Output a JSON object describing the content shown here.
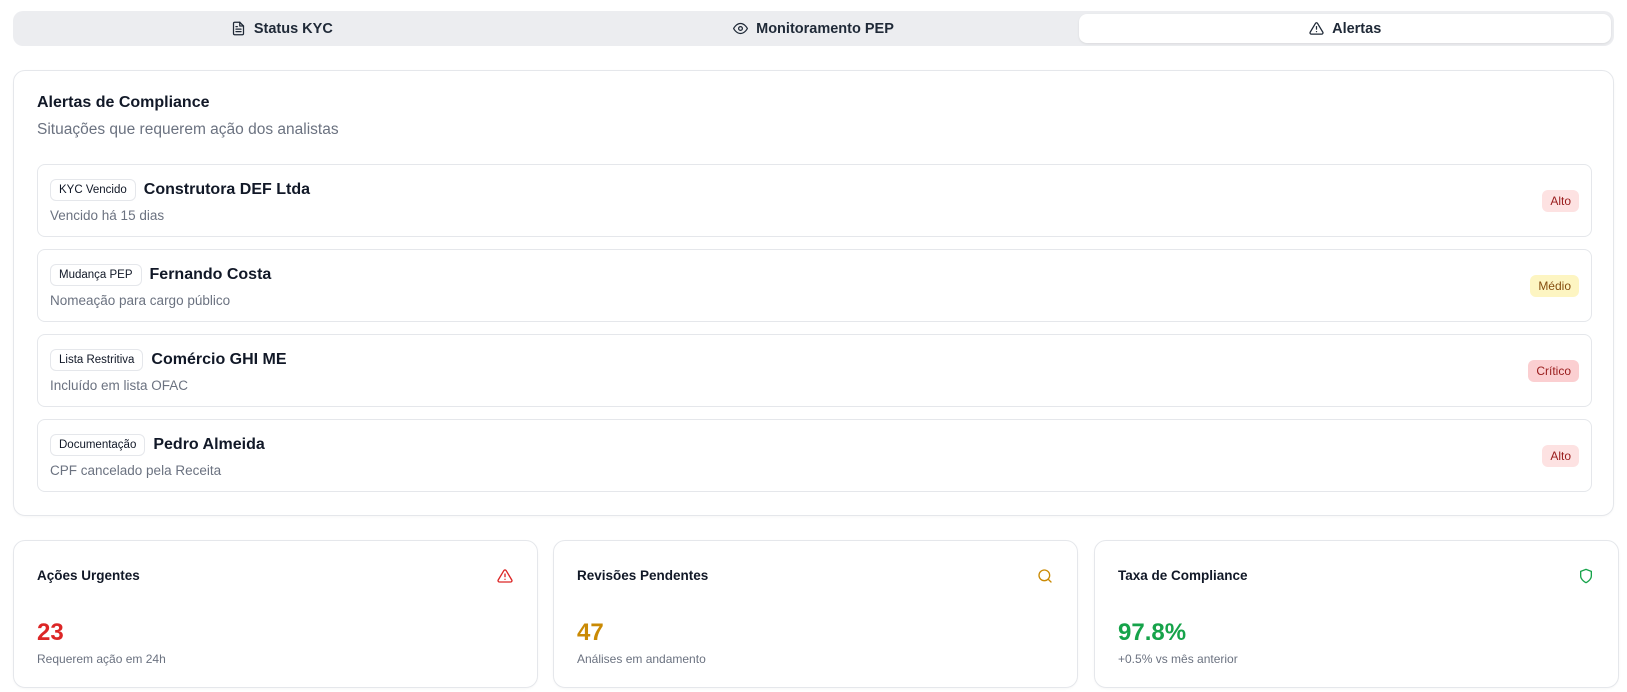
{
  "tabs": [
    {
      "label": "Status KYC",
      "icon": "document-icon",
      "active": false
    },
    {
      "label": "Monitoramento PEP",
      "icon": "eye-icon",
      "active": false
    },
    {
      "label": "Alertas",
      "icon": "warning-triangle-icon",
      "active": true
    }
  ],
  "alerts_card": {
    "title": "Alertas de Compliance",
    "subtitle": "Situações que requerem ação dos analistas",
    "items": [
      {
        "type": "KYC Vencido",
        "name": "Construtora DEF Ltda",
        "description": "Vencido há 15 dias",
        "severity": "Alto"
      },
      {
        "type": "Mudança PEP",
        "name": "Fernando Costa",
        "description": "Nomeação para cargo público",
        "severity": "Médio"
      },
      {
        "type": "Lista Restritiva",
        "name": "Comércio GHI ME",
        "description": "Incluído em lista OFAC",
        "severity": "Crítico"
      },
      {
        "type": "Documentação",
        "name": "Pedro Almeida",
        "description": "CPF cancelado pela Receita",
        "severity": "Alto"
      }
    ]
  },
  "stats": [
    {
      "title": "Ações Urgentes",
      "value": "23",
      "caption": "Requerem ação em 24h",
      "icon": "warning-triangle-icon",
      "color": "#dc2626"
    },
    {
      "title": "Revisões Pendentes",
      "value": "47",
      "caption": "Análises em andamento",
      "icon": "search-icon",
      "color": "#ca8a04"
    },
    {
      "title": "Taxa de Compliance",
      "value": "97.8%",
      "caption": "+0.5% vs mês anterior",
      "icon": "shield-icon",
      "color": "#16a34a"
    }
  ]
}
